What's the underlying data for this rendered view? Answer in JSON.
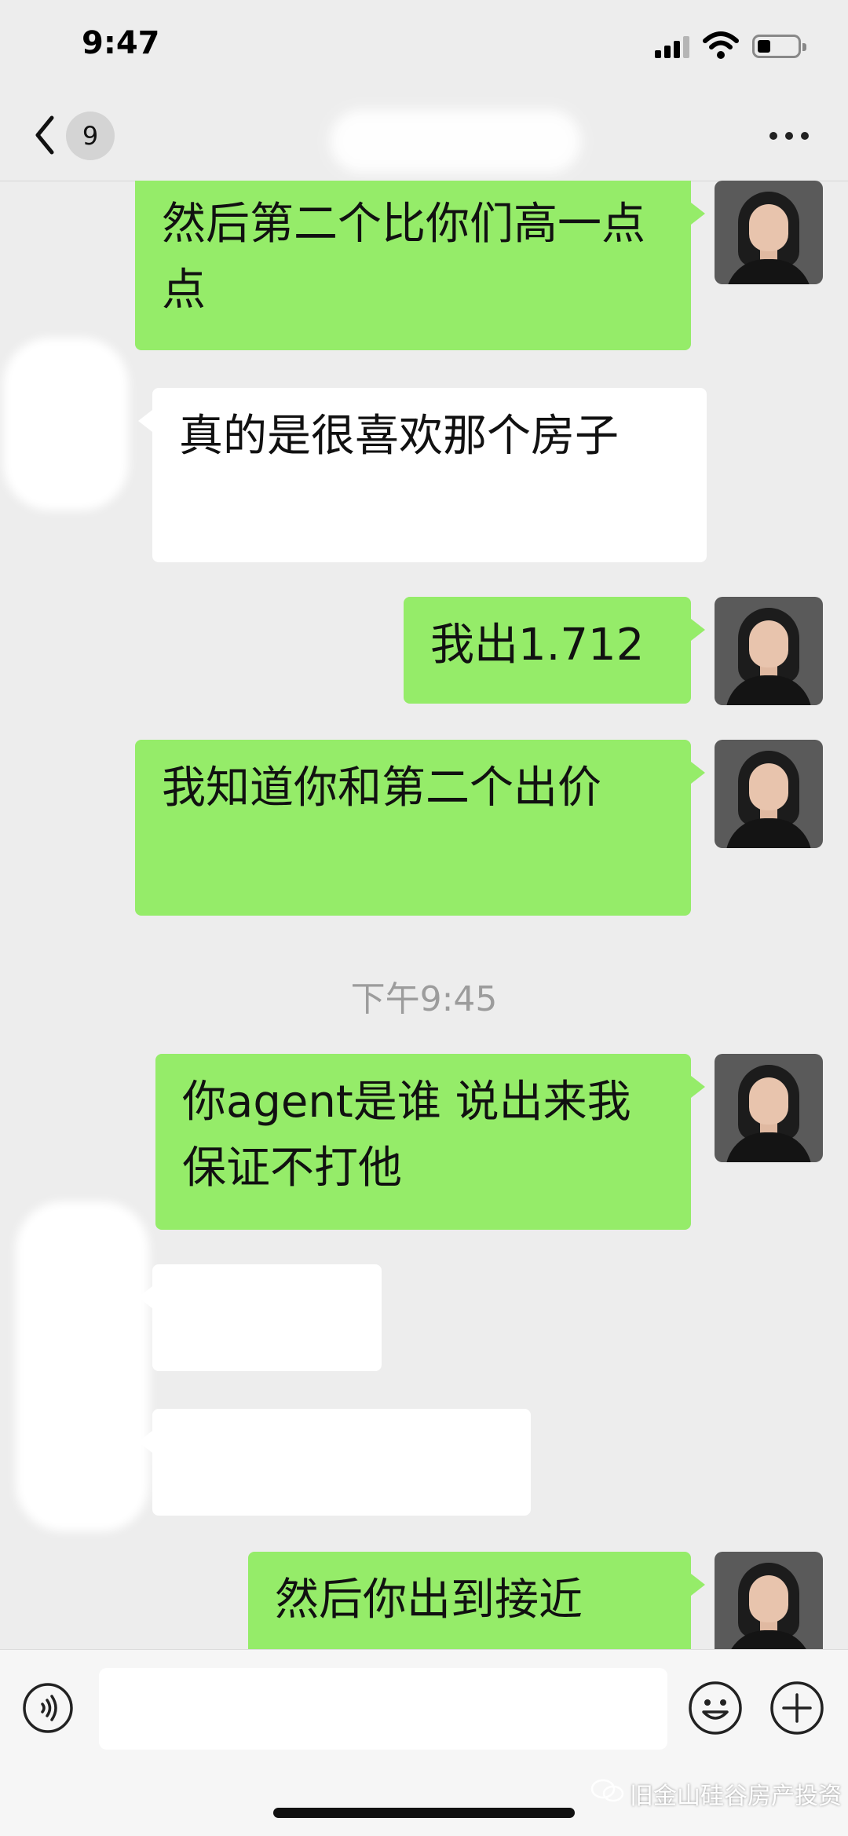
{
  "status_bar": {
    "time": "9:47"
  },
  "nav": {
    "unread_count": "9"
  },
  "messages": [
    {
      "from": "me",
      "text": "然后第二个比你们高一点点"
    },
    {
      "from": "other",
      "text": "真的是很喜欢那个房子"
    },
    {
      "from": "me",
      "text": "我出1.712"
    },
    {
      "from": "me",
      "text": "我知道你和第二个出价"
    },
    {
      "from": "me",
      "text": "你agent是谁 说出来我保证不打他"
    },
    {
      "from": "other",
      "text": ""
    },
    {
      "from": "other",
      "text": ""
    },
    {
      "from": "me",
      "text": "然后你出到接近"
    }
  ],
  "timestamp": "下午9:45",
  "watermark": "旧金山硅谷房产投资",
  "colors": {
    "me_bubble": "#95ec69",
    "other_bubble": "#ffffff",
    "background": "#ededed"
  },
  "icons": [
    "back-chevron-icon",
    "more-icon",
    "voice-icon",
    "emoji-icon",
    "plus-icon",
    "wechat-icon"
  ]
}
